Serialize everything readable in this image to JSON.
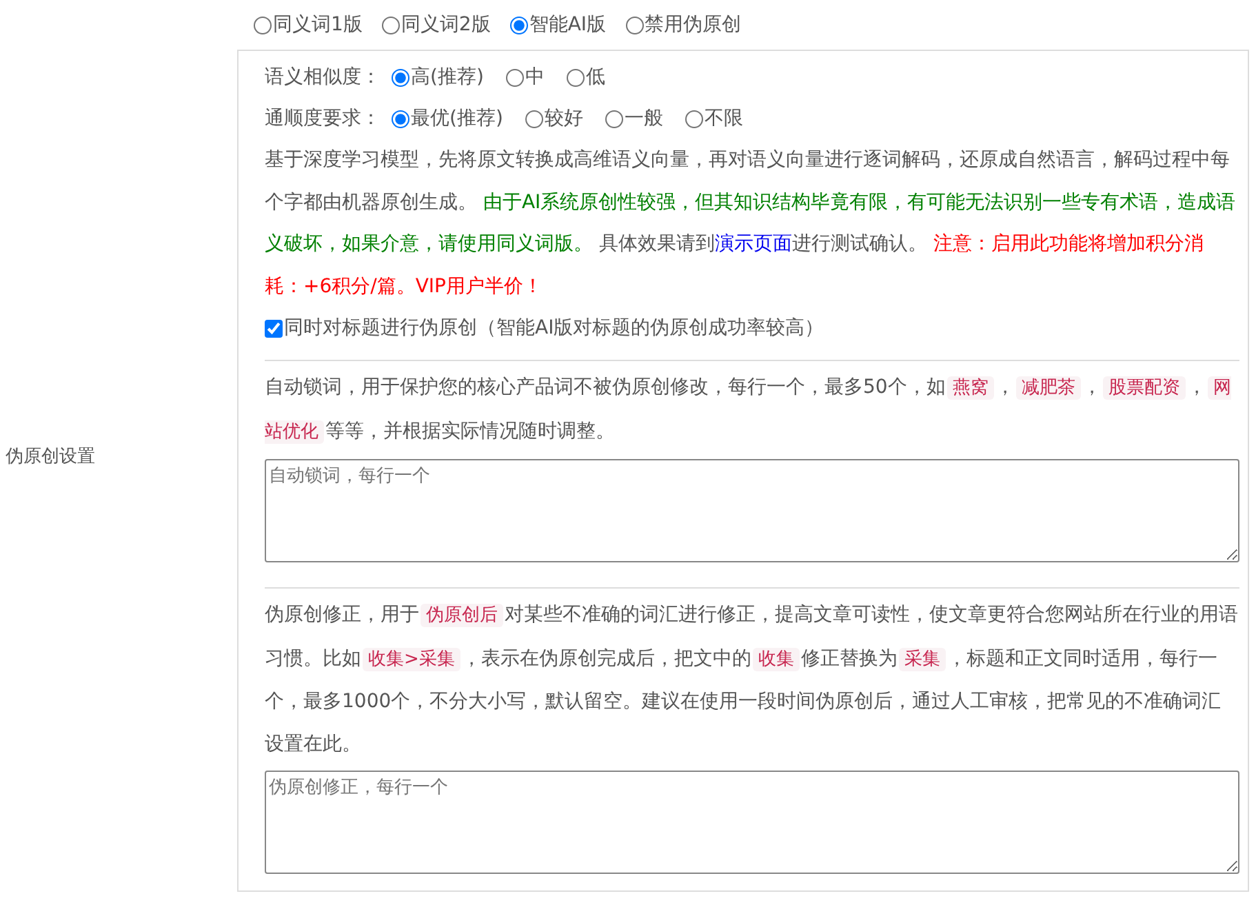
{
  "settings_label": "伪原创设置",
  "modes": [
    {
      "label": "同义词1版",
      "selected": false
    },
    {
      "label": "同义词2版",
      "selected": false
    },
    {
      "label": "智能AI版",
      "selected": true
    },
    {
      "label": "禁用伪原创",
      "selected": false
    }
  ],
  "ai_panel": {
    "option_groups": [
      {
        "label": "语义相似度：",
        "options": [
          {
            "label": "高(推荐)",
            "selected": true
          },
          {
            "label": "中",
            "selected": false
          },
          {
            "label": "低",
            "selected": false
          }
        ]
      },
      {
        "label": "通顺度要求：",
        "options": [
          {
            "label": "最优(推荐)",
            "selected": true
          },
          {
            "label": "较好",
            "selected": false
          },
          {
            "label": "一般",
            "selected": false
          },
          {
            "label": "不限",
            "selected": false
          }
        ]
      }
    ],
    "description": [
      {
        "kind": "text",
        "text": "基于深度学习模型，先将原文转换成高维语义向量，再对语义向量进行逐词解码，还原成自然语言，解码过程中每个字都由机器原创生成。 "
      },
      {
        "kind": "green",
        "text": "由于AI系统原创性较强，但其知识结构毕竟有限，有可能无法识别一些专有术语，造成语义破坏，如果介意，请使用同义词版。"
      },
      {
        "kind": "text",
        "text": " 具体效果请到"
      },
      {
        "kind": "link",
        "text": "演示页面"
      },
      {
        "kind": "text",
        "text": "进行测试确认。 "
      },
      {
        "kind": "red",
        "text": "注意：启用此功能将增加积分消耗：+6积分/篇。VIP用户半价！"
      }
    ],
    "title_checkbox": {
      "label": "同时对标题进行伪原创（智能AI版对标题的伪原创成功率较高）",
      "checked": true
    }
  },
  "lock_words": {
    "description": [
      {
        "kind": "text",
        "text": "自动锁词，用于保护您的核心产品词不被伪原创修改，每行一个，最多50个，如"
      },
      {
        "kind": "tag",
        "text": "燕窝"
      },
      {
        "kind": "text",
        "text": "，"
      },
      {
        "kind": "tag",
        "text": "减肥茶"
      },
      {
        "kind": "text",
        "text": "，"
      },
      {
        "kind": "tag",
        "text": "股票配资"
      },
      {
        "kind": "text",
        "text": "，"
      },
      {
        "kind": "tag",
        "text": "网站优化"
      },
      {
        "kind": "text",
        "text": "等等，并根据实际情况随时调整。"
      }
    ],
    "placeholder": "自动锁词，每行一个"
  },
  "correction": {
    "description": [
      {
        "kind": "text",
        "text": "伪原创修正，用于"
      },
      {
        "kind": "tag",
        "text": "伪原创后"
      },
      {
        "kind": "text",
        "text": "对某些不准确的词汇进行修正，提高文章可读性，使文章更符合您网站所在行业的用语习惯。比如"
      },
      {
        "kind": "tag",
        "text": "收集>采集"
      },
      {
        "kind": "text",
        "text": "，表示在伪原创完成后，把文中的"
      },
      {
        "kind": "tag",
        "text": "收集"
      },
      {
        "kind": "text",
        "text": "修正替换为"
      },
      {
        "kind": "tag",
        "text": "采集"
      },
      {
        "kind": "text",
        "text": "，标题和正文同时适用，每行一个，最多1000个，不分大小写，默认留空。建议在使用一段时间伪原创后，通过人工审核，把常见的不准确词汇设置在此。"
      }
    ],
    "placeholder": "伪原创修正，每行一个"
  }
}
